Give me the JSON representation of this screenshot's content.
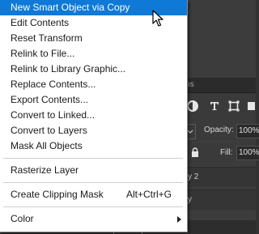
{
  "menu": {
    "items": [
      {
        "label": "New Smart Object via Copy"
      },
      {
        "label": "Edit Contents"
      },
      {
        "label": "Reset Transform"
      },
      {
        "label": "Relink to File..."
      },
      {
        "label": "Relink to Library Graphic..."
      },
      {
        "label": "Replace Contents..."
      },
      {
        "label": "Export Contents..."
      },
      {
        "label": "Convert to Linked..."
      },
      {
        "label": "Convert to Layers"
      },
      {
        "label": "Mask All Objects"
      },
      {
        "label": "Rasterize Layer"
      },
      {
        "label": "Create Clipping Mask",
        "shortcut": "Alt+Ctrl+G"
      },
      {
        "label": "Color"
      }
    ],
    "highlight_color": "#0f79d7"
  },
  "layers_panel": {
    "tab_fragment": "ıs",
    "opacity_label": "Opacity:",
    "opacity_value": "100%",
    "fill_label": "Fill:",
    "fill_value": "100%",
    "layer_fragments": [
      "y 2",
      "y"
    ]
  }
}
